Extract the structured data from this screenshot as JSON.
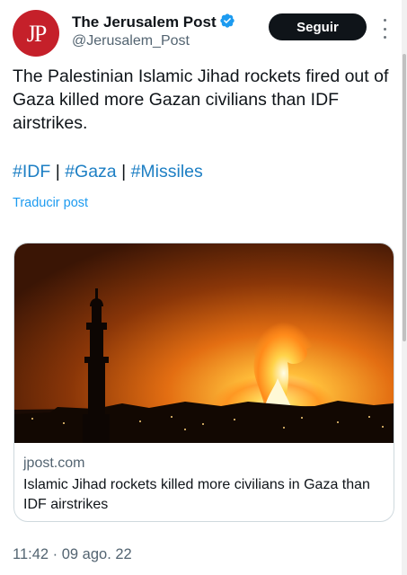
{
  "author": {
    "name": "The Jerusalem Post",
    "handle": "@Jerusalem_Post",
    "avatar_text": "JP"
  },
  "follow_button": {
    "label": "Seguir"
  },
  "post": {
    "text": "The Palestinian Islamic Jihad rockets fired out of Gaza killed more Gazan civilians than IDF airstrikes.",
    "hashtags": [
      "#IDF",
      "#Gaza",
      "#Missiles"
    ],
    "separator": "|",
    "translate_label": "Traducir post",
    "timestamp": "11:42 · 09 ago. 22"
  },
  "link_card": {
    "domain": "jpost.com",
    "title": "Islamic Jihad rockets killed more civilians in Gaza than IDF airstrikes"
  },
  "icons": {
    "verified": "verified-badge-icon",
    "more": "more-options-icon"
  },
  "colors": {
    "accent": "#1d9bf0",
    "hashtag": "#1d7fc4",
    "avatar_bg": "#c5202a",
    "button_bg": "#0f1419",
    "secondary_text": "#536471"
  }
}
